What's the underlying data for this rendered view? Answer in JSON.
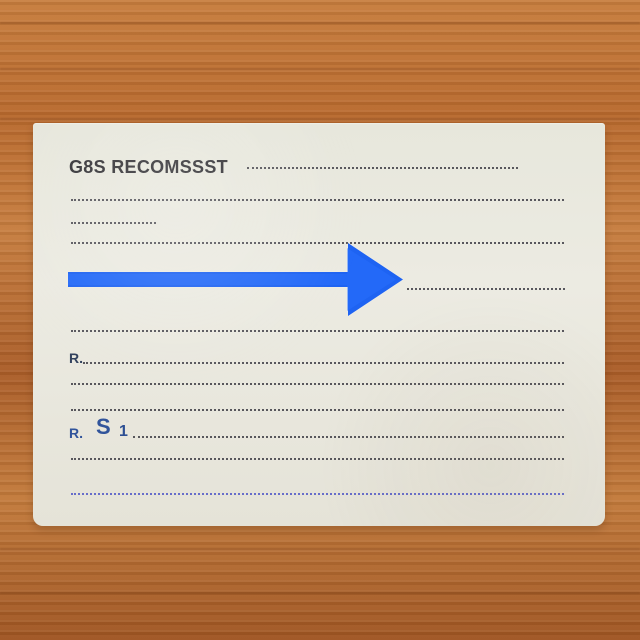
{
  "card": {
    "title": "G8S RECOMSSST",
    "marks": {
      "r1": "R.",
      "r2": "R.",
      "s": "S",
      "one": "1"
    }
  },
  "colors": {
    "arrow": "#1e63f2",
    "wood": "#b8692d",
    "card": "#ebe9df",
    "ink": "#363539",
    "blue_ink": "#31549b"
  },
  "icons": {
    "arrow": "right-arrow-icon"
  }
}
